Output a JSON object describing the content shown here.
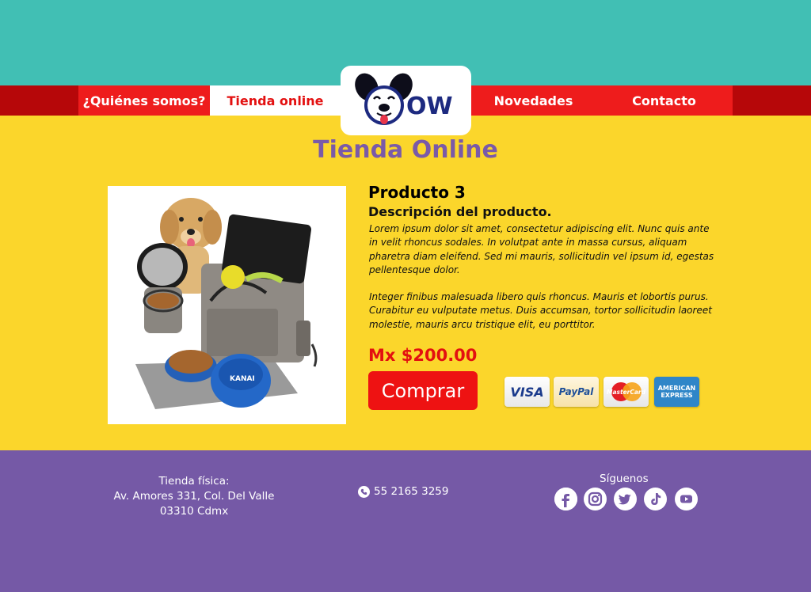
{
  "colors": {
    "top_bar": "#41bfb4",
    "nav_band": "#b60709",
    "nav_item": "#ee1c1c",
    "page_background": "#fbd62b",
    "title": "#7a5aa8",
    "price": "#e31010",
    "buy_button": "#ee1212",
    "footer": "#7559a6"
  },
  "logo": {
    "text": "OW",
    "icon": "dog-face-logo-icon"
  },
  "nav": {
    "items": [
      {
        "label": "¿Quiénes somos?",
        "active": false
      },
      {
        "label": "Tienda online",
        "active": true
      },
      {
        "label": "Novedades",
        "active": false
      },
      {
        "label": "Contacto",
        "active": false
      }
    ]
  },
  "page": {
    "title": "Tienda Online"
  },
  "product": {
    "image_icon": "dog-with-travel-bag-image",
    "name": "Producto 3",
    "description_title": "Descripción del producto.",
    "paragraph_1": "Lorem ipsum dolor sit amet, consectetur adipiscing elit. Nunc quis ante in velit rhoncus sodales. In volutpat ante in massa cursus, aliquam pharetra diam eleifend. Sed mi mauris, sollicitudin vel ipsum id, egestas pellentesque dolor.",
    "paragraph_2": "Integer finibus malesuada libero quis rhoncus. Mauris et lobortis purus. Curabitur eu vulputate metus. Duis accumsan, tortor sollicitudin laoreet molestie, mauris arcu tristique elit, eu porttitor.",
    "price": "Mx $200.00",
    "buy_label": "Comprar"
  },
  "payment": {
    "visa": "VISA",
    "paypal": "PayPal",
    "mastercard": "MasterCard",
    "amex_line1": "AMERICAN",
    "amex_line2": "EXPRESS"
  },
  "footer": {
    "store_line1": "Tienda física:",
    "store_line2": "Av. Amores 331, Col. Del Valle",
    "store_line3": "03310 Cdmx",
    "phone": "55 2165 3259",
    "follow": "Síguenos",
    "social": [
      "facebook-icon",
      "instagram-icon",
      "twitter-icon",
      "tiktok-icon",
      "youtube-icon"
    ]
  }
}
